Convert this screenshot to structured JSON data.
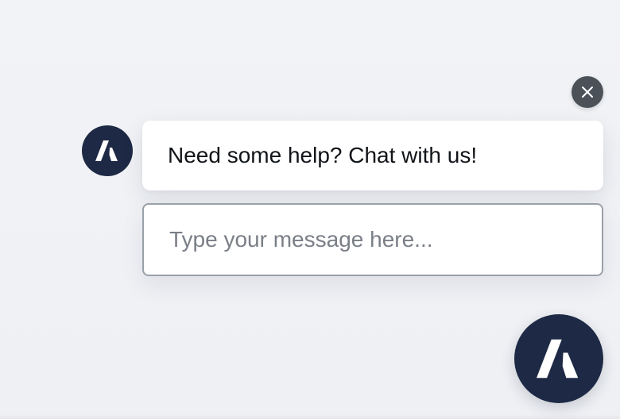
{
  "widget": {
    "greeting": "Need some help? Chat with us!",
    "input_placeholder": "Type your message here...",
    "input_value": ""
  },
  "icons": {
    "close": "close-icon",
    "avatar_logo": "brand-logo-icon",
    "launcher_logo": "brand-logo-icon"
  },
  "colors": {
    "brand_navy": "#1e2a45",
    "close_button": "#4b5158",
    "input_border": "#9aa0a8",
    "placeholder_text": "#7a7f87",
    "background": "#f2f3f6"
  }
}
